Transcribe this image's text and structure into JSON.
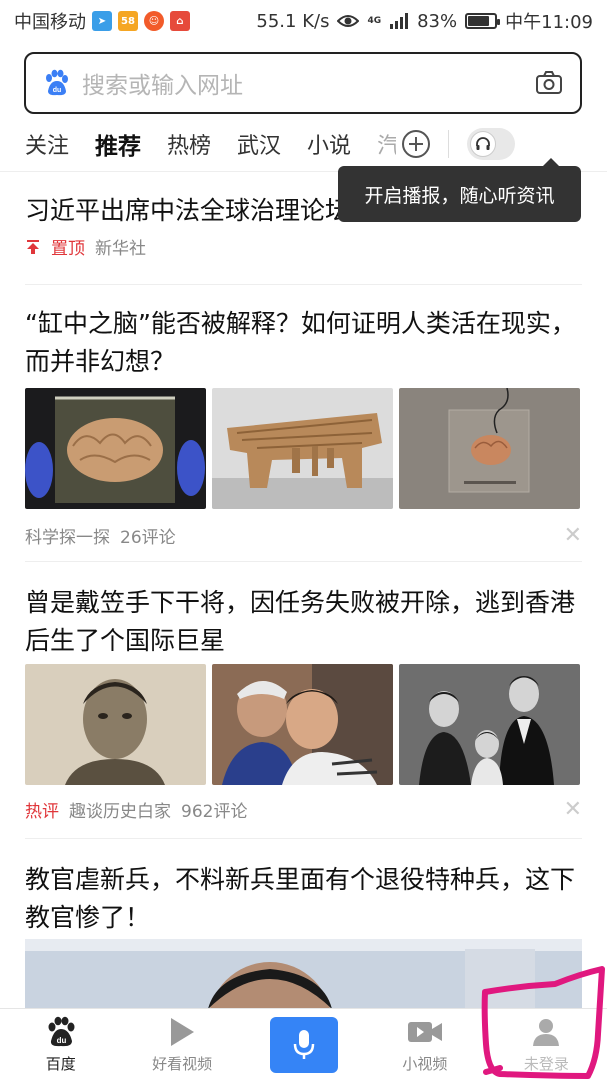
{
  "status_bar": {
    "carrier": "中国移动",
    "app_icons": [
      "paper-plane-icon",
      "58-app-icon",
      "face-app-icon",
      "shop-app-icon"
    ],
    "network_speed": "55.1 K/s",
    "network_type": "4G",
    "battery": "83%",
    "battery_level": 0.83,
    "time": "中午11:09"
  },
  "search": {
    "placeholder": "搜索或输入网址",
    "left_icon": "baidu-paw-icon",
    "right_icon": "camera-icon"
  },
  "tabs": [
    {
      "label": "关注",
      "active": false
    },
    {
      "label": "推荐",
      "active": true
    },
    {
      "label": "热榜",
      "active": false
    },
    {
      "label": "武汉",
      "active": false
    },
    {
      "label": "小说",
      "active": false
    },
    {
      "label": "汽",
      "active": false
    }
  ],
  "tooltip": "开启播报，随心听资讯",
  "feed": [
    {
      "title": "习近平出席中法全球治理论坛闭幕式",
      "tag": "置顶",
      "source": "新华社"
    },
    {
      "title": "“缸中之脑”能否被解释？如何证明人类活在现实，而并非幻想？",
      "source": "科学探一探",
      "comments": "26评论"
    },
    {
      "title": "曾是戴笠手下干将，因任务失败被开除，逃到香港后生了个国际巨星",
      "tag": "热评",
      "source": "趣谈历史白家",
      "comments": "962评论"
    },
    {
      "title": "教官虐新兵，不料新兵里面有个退役特种兵，这下教官惨了！"
    }
  ],
  "colors": {
    "accent_blue": "#3584f6",
    "tag_red": "#e0363a",
    "annotation_pink": "#e0187f"
  },
  "bottom_nav": [
    {
      "label": "百度",
      "icon": "baidu-paw-icon",
      "active": true
    },
    {
      "label": "好看视频",
      "icon": "play-icon",
      "active": false
    },
    {
      "label": "",
      "icon": "microphone-icon",
      "active": false
    },
    {
      "label": "小视频",
      "icon": "video-camera-icon",
      "active": false
    },
    {
      "label": "未登录",
      "icon": "user-icon",
      "active": false
    }
  ]
}
